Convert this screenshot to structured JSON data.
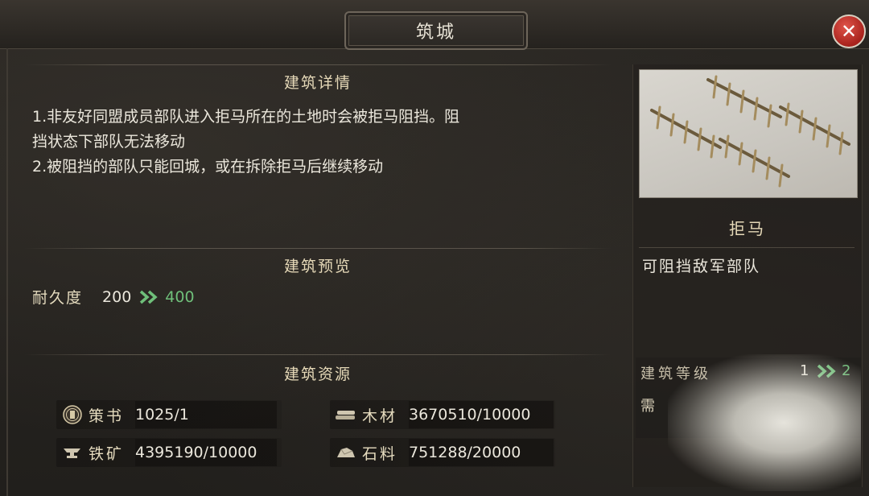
{
  "window": {
    "title": "筑城"
  },
  "close_button": {
    "label": "✕"
  },
  "details": {
    "heading": "建筑详情",
    "text": "1.非友好同盟成员部队进入拒马所在的土地时会被拒马阻挡。阻\n挡状态下部队无法移动\n2.被阻挡的部队只能回城，或在拆除拒马后继续移动"
  },
  "preview": {
    "heading": "建筑预览",
    "durability": {
      "label": "耐久度",
      "current": "200",
      "next": "400"
    }
  },
  "resources": {
    "heading": "建筑资源",
    "items": [
      {
        "icon": "scroll-seal-icon",
        "label": "策书",
        "value": "1025/1"
      },
      {
        "icon": "wood-icon",
        "label": "木材",
        "value": "3670510/10000"
      },
      {
        "icon": "anvil-icon",
        "label": "铁矿",
        "value": "4395190/10000"
      },
      {
        "icon": "stone-icon",
        "label": "石料",
        "value": "751288/20000"
      }
    ]
  },
  "building": {
    "name": "拒马",
    "description": "可阻挡敌军部队",
    "level_label": "建筑等级",
    "level_current": "1",
    "level_next": "2",
    "time_glyph": "需"
  },
  "colors": {
    "accent_green": "#6fbf7a",
    "heading_gold": "#e6d9b8",
    "close_red": "#c0332a"
  }
}
